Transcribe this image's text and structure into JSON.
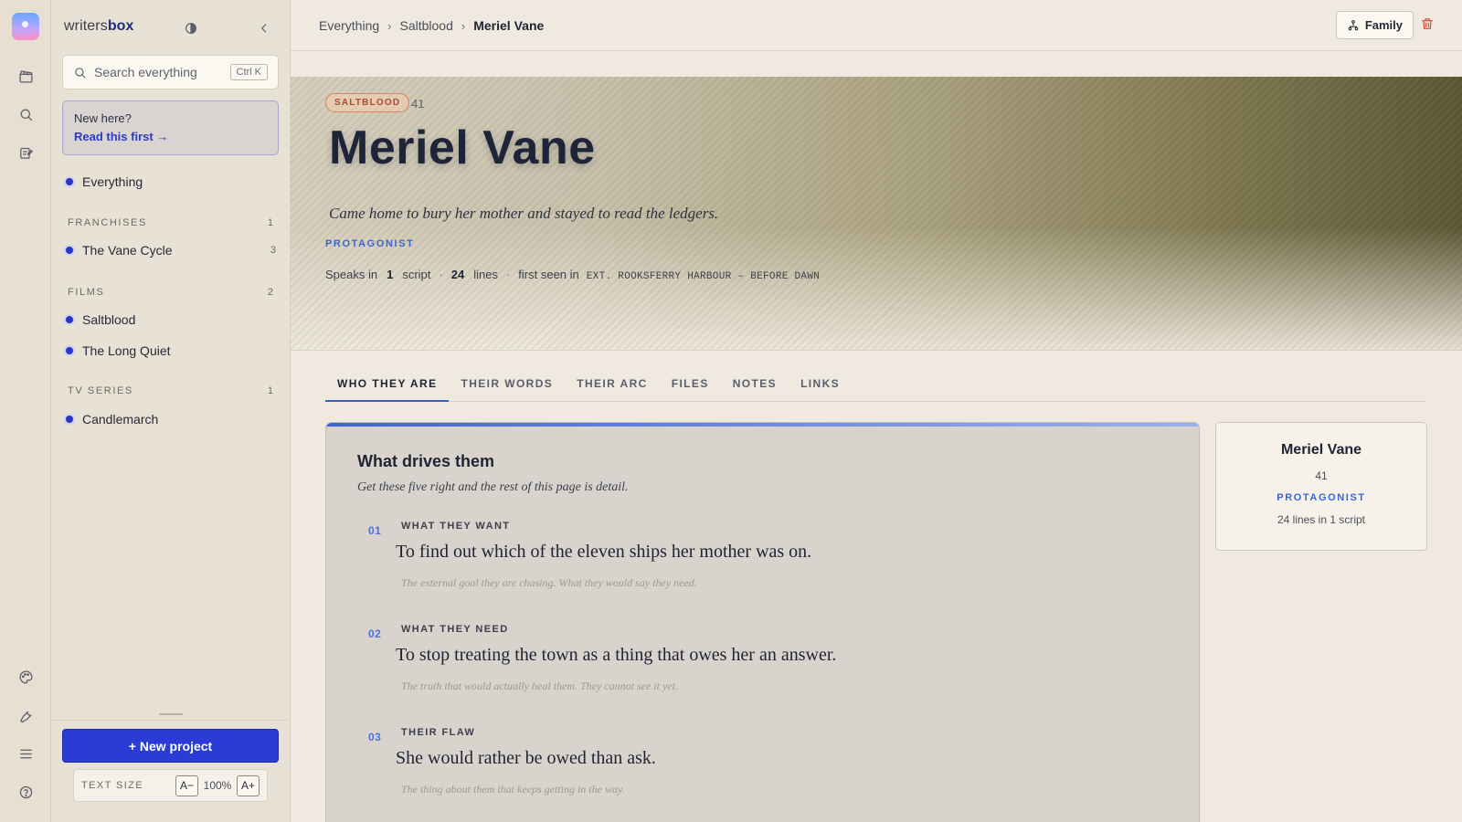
{
  "sidebar": {
    "brand_plain": "writers",
    "brand_bold": "box",
    "search_placeholder": "Search everything",
    "search_shortcut": "Ctrl K",
    "new_here_question": "New here?",
    "new_here_link": "Read this first",
    "everything": "Everything",
    "groups": [
      {
        "label": "FRANCHISES",
        "count": "1",
        "items": [
          {
            "label": "The Vane Cycle",
            "count": "3"
          }
        ]
      },
      {
        "label": "FILMS",
        "count": "2",
        "items": [
          {
            "label": "Saltblood"
          },
          {
            "label": "The Long Quiet"
          }
        ]
      },
      {
        "label": "TV SERIES",
        "count": "1",
        "items": [
          {
            "label": "Candlemarch"
          }
        ]
      }
    ],
    "new_project": "+ New project",
    "text_size_label": "TEXT SIZE",
    "text_size_decrease": "A−",
    "text_size_value": "100%",
    "text_size_increase": "A+"
  },
  "breadcrumb": [
    "Everything",
    "Saltblood",
    "Meriel Vane"
  ],
  "breadcrumb_separator": "›",
  "header": {
    "family_button": "Family"
  },
  "hero": {
    "badge": "SALTBLOOD",
    "age": "41",
    "name": "Meriel Vane",
    "tagline": "Came home to bury her mother and stayed to read the ledgers.",
    "role": "PROTAGONIST",
    "speaks_prefix": "Speaks in",
    "scripts_count": "1",
    "scripts_word": "script",
    "lines_count": "24",
    "lines_word": "lines",
    "first_seen_prefix": "first seen in",
    "first_seen_scene": "EXT. ROOKSFERRY HARBOUR – BEFORE DAWN",
    "dot": "·"
  },
  "tabs": [
    "WHO THEY ARE",
    "THEIR WORDS",
    "THEIR ARC",
    "FILES",
    "NOTES",
    "LINKS"
  ],
  "active_tab": "WHO THEY ARE",
  "drives": {
    "title": "What drives them",
    "subtitle": "Get these five right and the rest of this page is detail.",
    "items": [
      {
        "num": "01",
        "label": "WHAT THEY WANT",
        "value": "To find out which of the eleven ships her mother was on.",
        "hint": "The external goal they are chasing. What they would say they need."
      },
      {
        "num": "02",
        "label": "WHAT THEY NEED",
        "value": "To stop treating the town as a thing that owes her an answer.",
        "hint": "The truth that would actually heal them. They cannot see it yet."
      },
      {
        "num": "03",
        "label": "THEIR FLAW",
        "value": "She would rather be owed than ask.",
        "hint": "The thing about them that keeps getting in the way."
      }
    ]
  },
  "profile": {
    "name": "Meriel Vane",
    "age": "41",
    "role": "PROTAGONIST",
    "lines_summary": "24 lines in 1 script"
  },
  "colors": {
    "accent": "#2a3bd6",
    "role_blue": "#3b66d4",
    "badge_orange": "#b4482a",
    "danger": "#d8443b",
    "background": "#efe9df"
  }
}
